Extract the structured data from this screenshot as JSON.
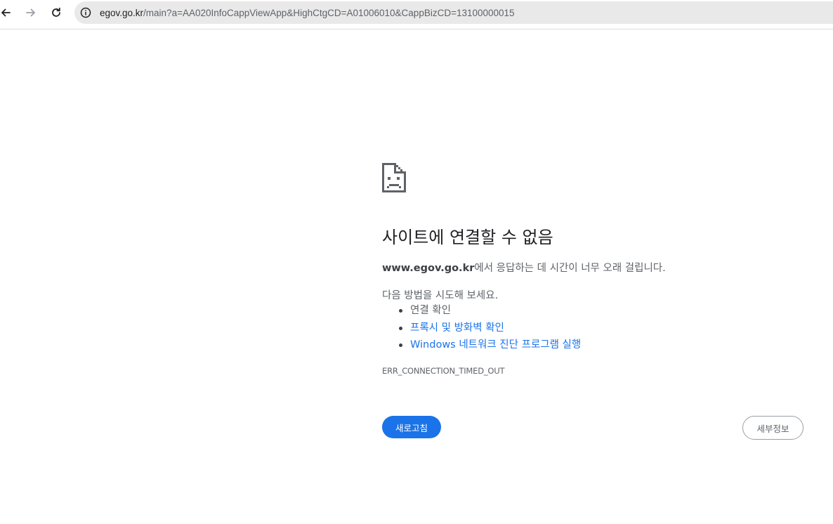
{
  "toolbar": {
    "back_icon": "arrow-left-icon",
    "forward_icon": "arrow-right-icon",
    "reload_icon": "reload-icon",
    "site_info_icon": "info-icon",
    "url_host": "egov.go.kr",
    "url_path": "/main?a=AA020InfoCappViewApp&HighCtgCD=A01006010&CappBizCD=13100000015"
  },
  "error": {
    "icon": "sad-document-icon",
    "title": "사이트에 연결할 수 없음",
    "host": "www.egov.go.kr",
    "message_suffix": "에서 응답하는 데 시간이 너무 오래 걸립니다.",
    "suggest_head": "다음 방법을 시도해 보세요.",
    "suggestions": [
      {
        "label": "연결 확인",
        "link": false
      },
      {
        "label": "프록시 및 방화벽 확인",
        "link": true
      },
      {
        "label": "Windows 네트워크 진단 프로그램 실행",
        "link": true
      }
    ],
    "code": "ERR_CONNECTION_TIMED_OUT"
  },
  "buttons": {
    "reload": "새로고침",
    "details": "세부정보"
  },
  "colors": {
    "accent": "#1a73e8",
    "text_primary": "#202124",
    "text_secondary": "#5f6368",
    "omnibox_bg": "#e9e9e9"
  }
}
